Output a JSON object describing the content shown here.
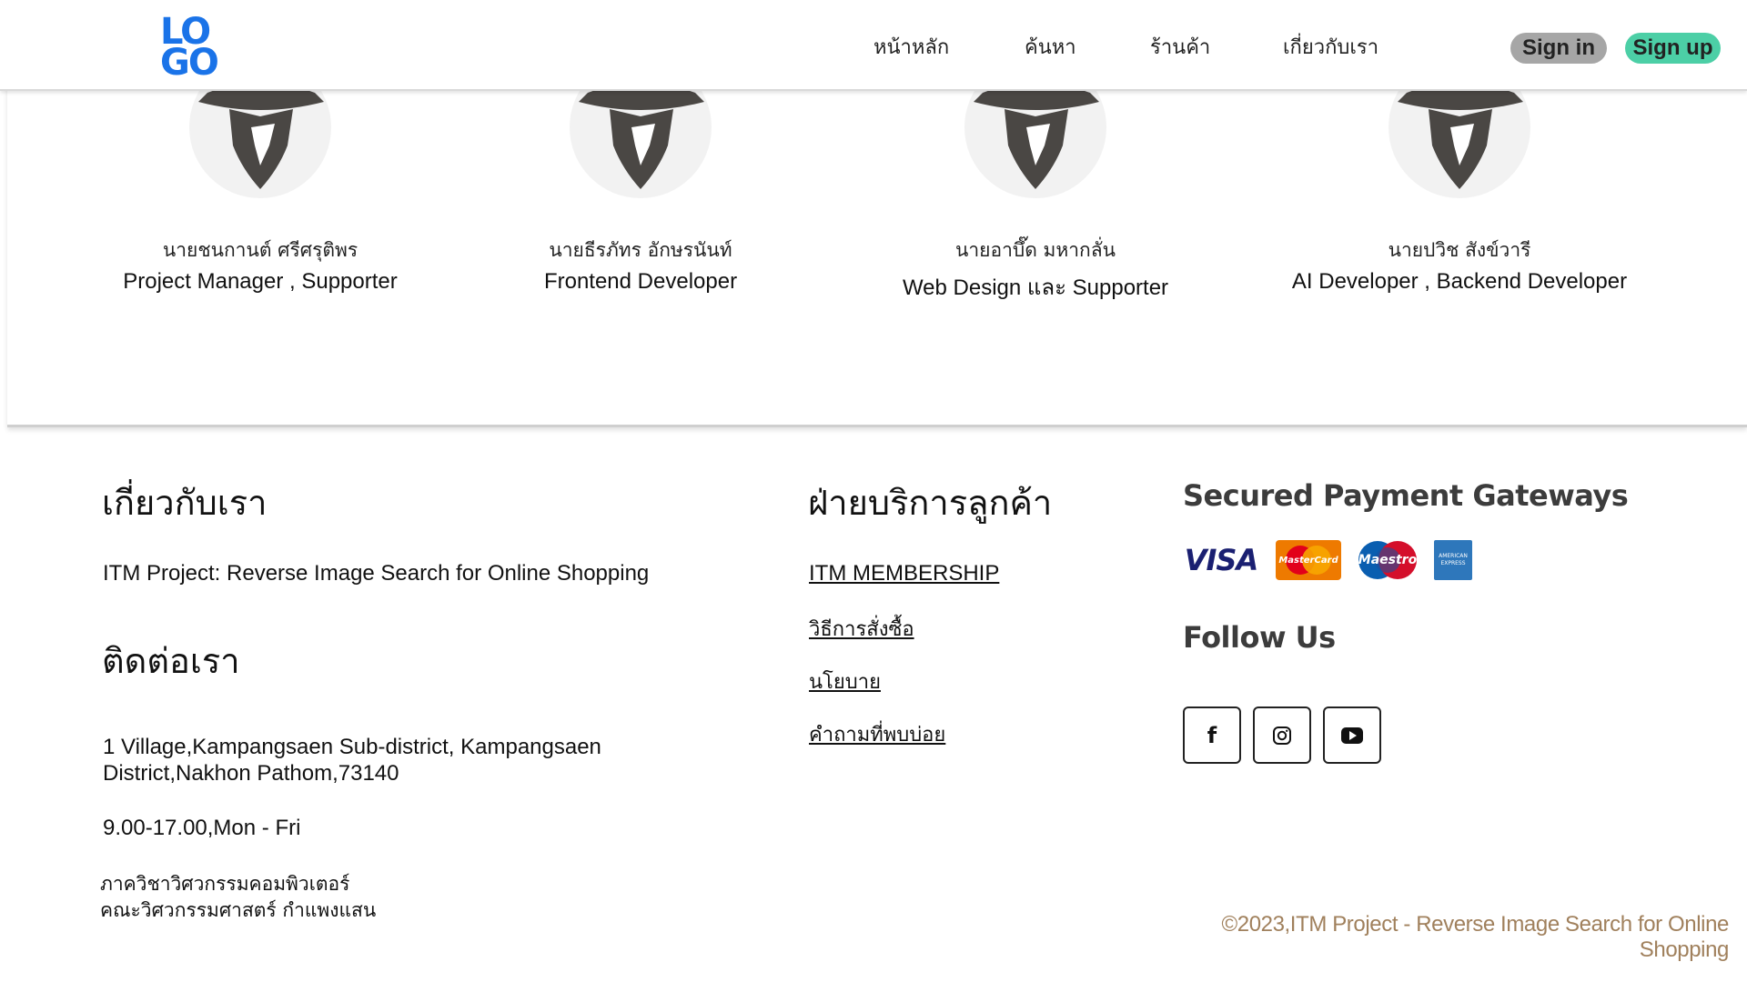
{
  "header": {
    "logo_line1": "LO",
    "logo_line2": "GO",
    "nav": [
      {
        "label": "หน้าหลัก"
      },
      {
        "label": "ค้นหา"
      },
      {
        "label": "ร้านค้า"
      },
      {
        "label": "เกี่ยวกับเรา"
      }
    ],
    "signin_label": "Sign in",
    "signup_label": "Sign up"
  },
  "team": [
    {
      "name": "นายชนกานต์ ศรีศรุติพร",
      "role": "Project Manager , Supporter"
    },
    {
      "name": "นายธีรภัทร อักษรนันท์",
      "role": "Frontend Developer"
    },
    {
      "name": "นายอาบึ๊ด มหากลั่น",
      "role": "Web Design และ Supporter"
    },
    {
      "name": "นายปวิช สังข์วารี",
      "role": "AI Developer , Backend Developer"
    }
  ],
  "footer": {
    "about_heading": "เกี่ยวกับเรา",
    "about_text": "ITM Project: Reverse Image Search for Online Shopping",
    "contact_heading": "ติดต่อเรา",
    "address_line1": "1 Village,Kampangsaen Sub-district, Kampangsaen",
    "address_line2": "District,Nakhon Pathom,73140",
    "hours": "9.00-17.00,Mon - Fri",
    "dept_line1": "ภาควิชาวิศวกรรมคอมพิวเตอร์",
    "dept_line2": "คณะวิศวกรรมศาสตร์ กำแพงแสน",
    "service_heading": "ฝ่ายบริการลูกค้า",
    "service_links": [
      {
        "label": "ITM MEMBERSHIP"
      },
      {
        "label": "วิธีการสั่งซื้อ"
      },
      {
        "label": "นโยบาย"
      },
      {
        "label": "คำถามที่พบบ่อย"
      }
    ],
    "gateways_heading": "Secured Payment Gateways",
    "gateways": [
      {
        "label": "VISA",
        "icon": "visa-logo"
      },
      {
        "label": "MasterCard",
        "icon": "mastercard-logo"
      },
      {
        "label": "Maestro",
        "icon": "maestro-logo"
      },
      {
        "label": "AMERICAN EXPRESS",
        "icon": "amex-logo"
      }
    ],
    "follow_heading": "Follow Us",
    "social": [
      {
        "icon": "facebook-icon",
        "glyph": "f"
      },
      {
        "icon": "instagram-icon"
      },
      {
        "icon": "youtube-icon"
      }
    ],
    "copyright": "©2023,ITM Project - Reverse Image Search for Online Shopping"
  },
  "colors": {
    "logo": "#1a73e8",
    "signin_bg": "#a6a6a6",
    "signup_bg": "#4ccfa6",
    "copyright": "#a0805c",
    "visa": "#1a1f71",
    "mastercard_bg": "#ee7a00",
    "maestro_bg": "#0a5eb0",
    "amex_bg": "#2e77bb"
  }
}
